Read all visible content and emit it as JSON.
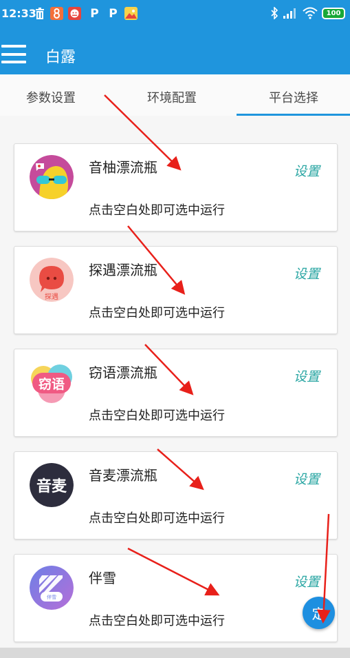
{
  "status_bar": {
    "time": "12:33",
    "battery": "100",
    "icons": [
      "trash-icon",
      "app-icon-8",
      "app-icon-face",
      "p-icon",
      "p-icon",
      "photo-icon",
      "bluetooth-icon",
      "signal-icon",
      "wifi-icon"
    ],
    "p_label": "P"
  },
  "app_bar": {
    "title": "白露"
  },
  "tabs": [
    {
      "label": "参数设置"
    },
    {
      "label": "环境配置"
    },
    {
      "label": "平台选择",
      "active": true
    }
  ],
  "platforms": [
    {
      "name": "音柚漂流瓶",
      "desc": "点击空白处即可选中运行",
      "settings": "设置",
      "logo": "yinyou-logo"
    },
    {
      "name": "探遇漂流瓶",
      "desc": "点击空白处即可选中运行",
      "settings": "设置",
      "logo": "tanyu-logo",
      "logo_text": "探遇"
    },
    {
      "name": "窃语漂流瓶",
      "desc": "点击空白处即可选中运行",
      "settings": "设置",
      "logo": "qieyu-logo",
      "logo_text": "窃语"
    },
    {
      "name": "音麦漂流瓶",
      "desc": "点击空白处即可选中运行",
      "settings": "设置",
      "logo": "yinmai-logo",
      "logo_text": "音麦"
    },
    {
      "name": "伴雪",
      "desc": "点击空白处即可选中运行",
      "settings": "设置",
      "logo": "banxue-logo",
      "logo_text": "伴雪"
    }
  ],
  "fab": {
    "label": "定"
  },
  "colors": {
    "primary": "#1f95dd",
    "settings_text": "#2aa6a3",
    "annotation_arrow": "#e8201a"
  }
}
